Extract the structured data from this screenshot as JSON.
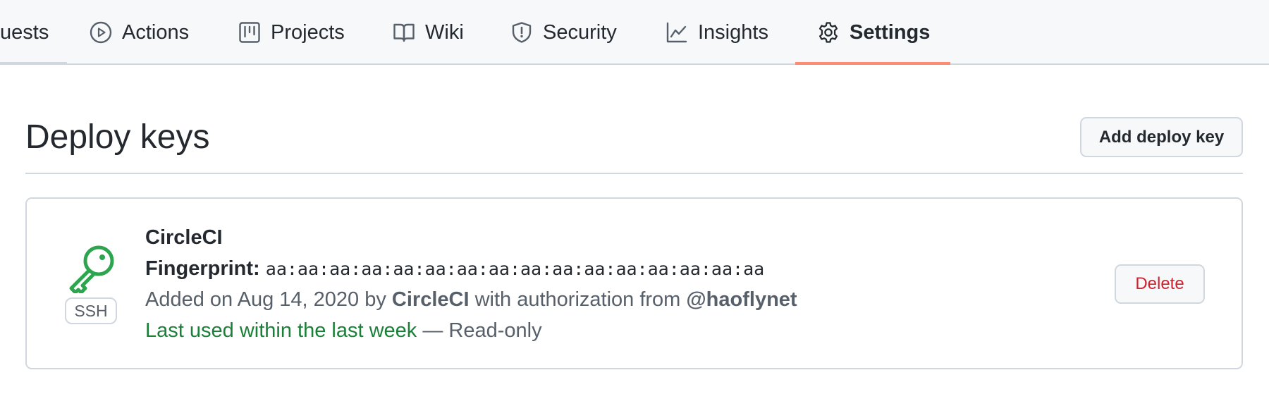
{
  "colors": {
    "nav_bg": "#f6f8fa",
    "active_underline": "#fd8c73",
    "ssh_key_green": "#2da44e",
    "delete_red": "#cf222e",
    "last_used_green": "#1a7f37"
  },
  "nav": {
    "tabs": [
      {
        "label": "uests",
        "icon": "git-pull-request-icon",
        "active": false
      },
      {
        "label": "Actions",
        "icon": "play-circle-icon",
        "active": false
      },
      {
        "label": "Projects",
        "icon": "project-board-icon",
        "active": false
      },
      {
        "label": "Wiki",
        "icon": "book-icon",
        "active": false
      },
      {
        "label": "Security",
        "icon": "shield-icon",
        "active": false
      },
      {
        "label": "Insights",
        "icon": "graph-icon",
        "active": false
      },
      {
        "label": "Settings",
        "icon": "gear-icon",
        "active": true
      }
    ]
  },
  "page": {
    "title": "Deploy keys",
    "add_button_label": "Add deploy key"
  },
  "deploy_key": {
    "name": "CircleCI",
    "type_badge": "SSH",
    "icon": "key-icon",
    "fingerprint_label": "Fingerprint:",
    "fingerprint_value": "aa:aa:aa:aa:aa:aa:aa:aa:aa:aa:aa:aa:aa:aa:aa:aa",
    "added_prefix": "Added on Aug 14, 2020 by",
    "added_by": "CircleCI",
    "added_middle": "with authorization from",
    "authorized_by": "@haoflynet",
    "last_used": "Last used within the last week",
    "access_suffix": "— Read-only",
    "delete_label": "Delete"
  }
}
